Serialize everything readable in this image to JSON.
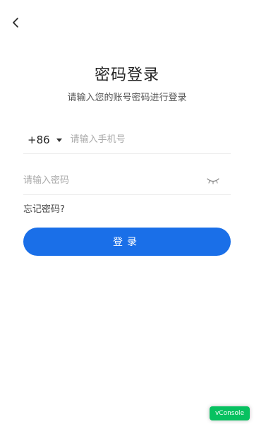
{
  "header": {
    "back_icon": "chevron-left-icon"
  },
  "title": "密码登录",
  "subtitle": "请输入您的账号密码进行登录",
  "phone": {
    "country_code": "+86",
    "caret_icon": "caret-down-icon",
    "value": "",
    "placeholder": "请输入手机号"
  },
  "password": {
    "value": "",
    "placeholder": "请输入密码",
    "toggle_icon": "eye-closed-icon"
  },
  "forgot_label": "忘记密码?",
  "login_label": "登录",
  "vconsole_label": "vConsole",
  "colors": {
    "primary": "#1a6fe8",
    "vconsole": "#07c160",
    "placeholder": "#aaaaaa",
    "divider": "#ececec"
  }
}
